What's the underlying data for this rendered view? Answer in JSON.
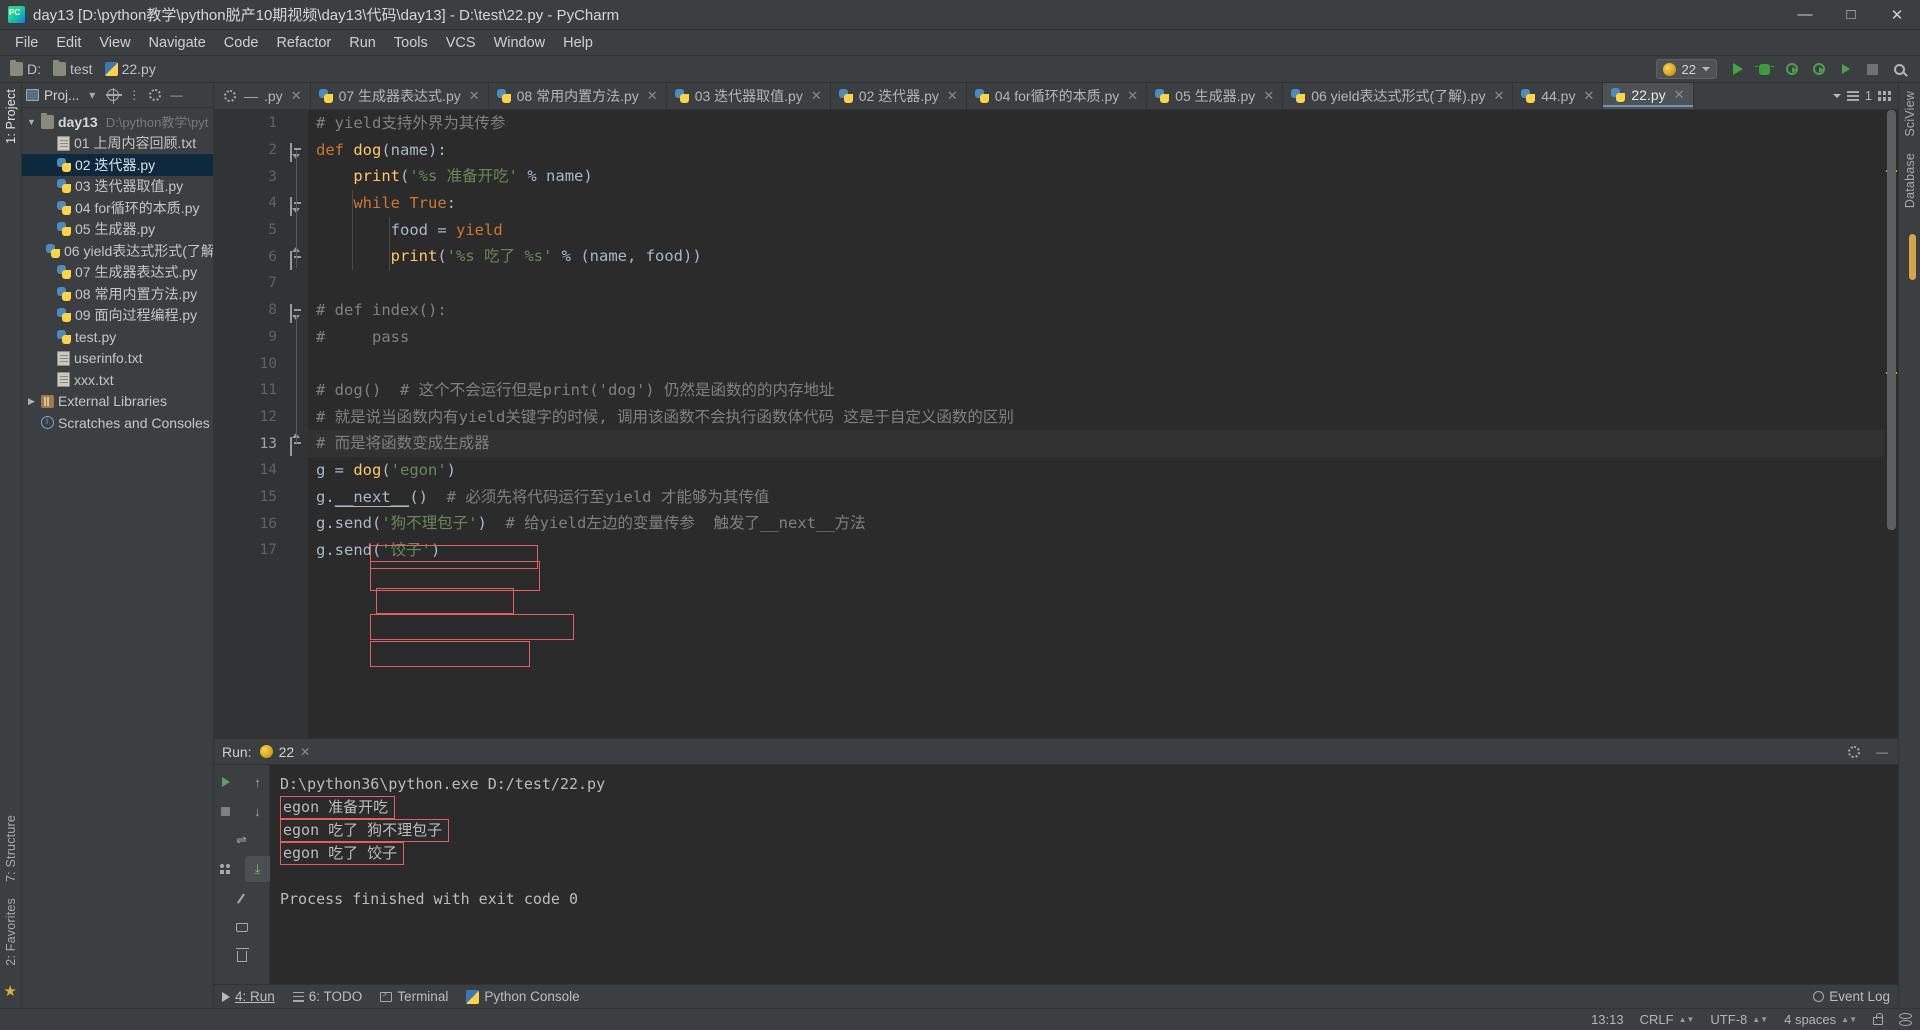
{
  "window": {
    "title": "day13 [D:\\python教学\\python脱产10期视频\\day13\\代码\\day13] - D:\\test\\22.py - PyCharm",
    "minimize": "—",
    "maximize": "□",
    "close": "✕",
    "logo_text": "PC"
  },
  "menubar": {
    "items": [
      "File",
      "Edit",
      "View",
      "Navigate",
      "Code",
      "Refactor",
      "Run",
      "Tools",
      "VCS",
      "Window",
      "Help"
    ]
  },
  "navbar": {
    "breadcrumbs": [
      {
        "label": "D:",
        "icon": "folder-icon"
      },
      {
        "label": "test",
        "icon": "folder-icon"
      },
      {
        "label": "22.py",
        "icon": "python-file-icon"
      }
    ],
    "run_config": {
      "name": "22",
      "icon": "python-config-icon",
      "dropdown": "▾"
    },
    "buttons": [
      "run-button",
      "debug-button",
      "run-coverage-button",
      "profile-button",
      "attach-button",
      "stop-button",
      "search-everywhere-button"
    ]
  },
  "left_rail": {
    "labels": [
      "1: Project"
    ]
  },
  "right_rail": {
    "labels": [
      "SciView",
      "Database"
    ]
  },
  "bottom_left_rail": {
    "labels": [
      "7: Structure",
      "2: Favorites"
    ]
  },
  "project_panel": {
    "title": "Proj...",
    "title_dropdown": "▾",
    "toolbar_icons": [
      "locate-icon",
      "collapse-all-icon",
      "settings-icon",
      "hide-icon"
    ],
    "tree": [
      {
        "level": 0,
        "arrow": "▼",
        "icon": "folder-icon",
        "label": "day13",
        "bold": true,
        "path": "D:\\python教学\\pyt",
        "selected": false
      },
      {
        "level": 1,
        "arrow": "",
        "icon": "text-file-icon",
        "label": "01 上周内容回顾.txt",
        "selected": false
      },
      {
        "level": 1,
        "arrow": "",
        "icon": "python-file-icon",
        "label": "02 迭代器.py",
        "selected": true
      },
      {
        "level": 1,
        "arrow": "",
        "icon": "python-file-icon",
        "label": "03 迭代器取值.py",
        "selected": false
      },
      {
        "level": 1,
        "arrow": "",
        "icon": "python-file-icon",
        "label": "04 for循环的本质.py",
        "selected": false
      },
      {
        "level": 1,
        "arrow": "",
        "icon": "python-file-icon",
        "label": "05 生成器.py",
        "selected": false
      },
      {
        "level": 1,
        "arrow": "",
        "icon": "python-file-icon",
        "label": "06 yield表达式形式(了解",
        "selected": false
      },
      {
        "level": 1,
        "arrow": "",
        "icon": "python-file-icon",
        "label": "07 生成器表达式.py",
        "selected": false
      },
      {
        "level": 1,
        "arrow": "",
        "icon": "python-file-icon",
        "label": "08 常用内置方法.py",
        "selected": false
      },
      {
        "level": 1,
        "arrow": "",
        "icon": "python-file-icon",
        "label": "09 面向过程编程.py",
        "selected": false
      },
      {
        "level": 1,
        "arrow": "",
        "icon": "python-file-icon",
        "label": "test.py",
        "selected": false
      },
      {
        "level": 1,
        "arrow": "",
        "icon": "text-file-icon",
        "label": "userinfo.txt",
        "selected": false
      },
      {
        "level": 1,
        "arrow": "",
        "icon": "text-file-icon",
        "label": "xxx.txt",
        "selected": false
      },
      {
        "level": 0,
        "arrow": "▶",
        "icon": "library-icon",
        "label": "External Libraries",
        "selected": false
      },
      {
        "level": 0,
        "arrow": "",
        "icon": "scratches-icon",
        "label": "Scratches and Consoles",
        "selected": false
      }
    ]
  },
  "editor_tabs": {
    "tabs": [
      {
        "label": ".py",
        "icon": "python-file-icon",
        "active": false,
        "truncated": true
      },
      {
        "label": "07 生成器表达式.py",
        "icon": "python-file-icon",
        "active": false
      },
      {
        "label": "08 常用内置方法.py",
        "icon": "python-file-icon",
        "active": false
      },
      {
        "label": "03 迭代器取值.py",
        "icon": "python-file-icon",
        "active": false
      },
      {
        "label": "02 迭代器.py",
        "icon": "python-file-icon",
        "active": false
      },
      {
        "label": "04 for循环的本质.py",
        "icon": "python-file-icon",
        "active": false
      },
      {
        "label": "05 生成器.py",
        "icon": "python-file-icon",
        "active": false
      },
      {
        "label": "06 yield表达式形式(了解).py",
        "icon": "python-file-icon",
        "active": false
      },
      {
        "label": "44.py",
        "icon": "python-file-icon",
        "active": false
      },
      {
        "label": "22.py",
        "icon": "python-file-icon",
        "active": true
      }
    ],
    "close_glyph": "✕",
    "overflow_count": "1",
    "overflow_glyph": "▾"
  },
  "code": {
    "lines": [
      {
        "n": "1",
        "html": "<span class='cmt'># yield支持外界为其传参</span>"
      },
      {
        "n": "2",
        "html": "<span class='kw'>def</span> <span class='fn'>dog</span><span class='def'>(name):</span>"
      },
      {
        "n": "3",
        "html": "    <span class='fn'>print</span><span class='def'>(</span><span class='str'>'%s 准备开吃'</span> <span class='def'>%</span> <span class='def'>name)</span>"
      },
      {
        "n": "4",
        "html": "    <span class='kw'>while</span> <span class='kw'>True</span><span class='def'>:</span>"
      },
      {
        "n": "5",
        "html": "        <span class='def'>food =</span> <span class='kw'>yield</span>"
      },
      {
        "n": "6",
        "html": "        <span class='fn'>print</span><span class='def'>(</span><span class='str'>'%s 吃了 %s'</span> <span class='def'>% (name, food))</span>"
      },
      {
        "n": "7",
        "html": ""
      },
      {
        "n": "8",
        "html": "<span class='cmt'># def index():</span>"
      },
      {
        "n": "9",
        "html": "<span class='cmt'>#     pass</span>"
      },
      {
        "n": "10",
        "html": ""
      },
      {
        "n": "11",
        "html": "<span class='cmt'># dog()  # 这个不会运行但是print('dog') 仍然是函数的的内存地址</span>"
      },
      {
        "n": "12",
        "html": "<span class='cmt'># 就是说当函数内有yield关键字的时候, 调用该函数不会执行函数体代码 这是于自定义函数的区别</span>"
      },
      {
        "n": "13",
        "html": "<span class='cmt'># 而是将函数变成生成器</span>"
      },
      {
        "n": "14",
        "html": "<span class='def'>g = </span><span class='fn'>dog</span><span class='def'>(</span><span class='str'>'egon'</span><span class='def'>)</span>"
      },
      {
        "n": "15",
        "html": "<span class='def'>g.</span><span class='mag-under'>__next__</span><span class='def'>()</span>  <span class='cmt'># 必须先将代码运行至yield 才能够为其传值</span>"
      },
      {
        "n": "16",
        "html": "<span class='def'>g.send(</span><span class='str'>'狗不理包子'</span><span class='def'>)</span>  <span class='cmt'># 给yield左边的变量传参  触发了__next__方法</span>"
      },
      {
        "n": "17",
        "html": "<span class='def'>g.send(</span><span class='str'>'饺子'</span><span class='def'>)</span>"
      }
    ],
    "current_line": 13,
    "annotations_label": [
      "line-14-box",
      "line-15-box",
      "line-16-box",
      "line-17-box",
      "line-13-box"
    ]
  },
  "run_panel": {
    "label": "Run:",
    "tab_name": "22",
    "close_glyph": "✕",
    "settings_icon": "gear-icon",
    "minimize_icon": "minimize-icon",
    "rail_buttons": [
      "rerun-button",
      "up-button",
      "stop-button",
      "down-button",
      "print-button",
      "soft-wrap-button",
      "scroll-to-end-button",
      "pin-button",
      "print-output-button",
      "clear-all-button"
    ],
    "console_lines": [
      {
        "text": "D:\\python36\\python.exe D:/test/22.py",
        "boxed": false
      },
      {
        "text": "egon 准备开吃",
        "boxed": true
      },
      {
        "text": "egon 吃了 狗不理包子",
        "boxed": true
      },
      {
        "text": "egon 吃了 饺子",
        "boxed": true
      },
      {
        "text": "",
        "boxed": false
      },
      {
        "text": "Process finished with exit code 0",
        "boxed": false
      }
    ]
  },
  "bottom_bar": {
    "items": [
      {
        "label": "4: Run",
        "icon": "play-icon",
        "active": true
      },
      {
        "label": "6: TODO",
        "icon": "todo-icon",
        "active": false
      },
      {
        "label": "Terminal",
        "icon": "terminal-icon",
        "active": false
      },
      {
        "label": "Python Console",
        "icon": "python-console-icon",
        "active": false
      }
    ],
    "event_log": {
      "label": "Event Log",
      "icon": "bell-icon"
    }
  },
  "status_bar": {
    "caret": "13:13",
    "line_sep": "CRLF",
    "encoding": "UTF-8",
    "indent": "4 spaces",
    "lock_icon": "lock-icon",
    "branch_icon": "branch-icon",
    "updown": "⇅"
  },
  "colors": {
    "accent": "#4b6eaf",
    "annotation_red": "#e0615f",
    "selection_blue": "#0d293e",
    "editor_bg": "#2b2b2b",
    "chrome_bg": "#3c3f41",
    "keyword_orange": "#cc7832",
    "string_green": "#6a8759",
    "function_yellow": "#ffc66d",
    "comment_gray": "#808080"
  }
}
